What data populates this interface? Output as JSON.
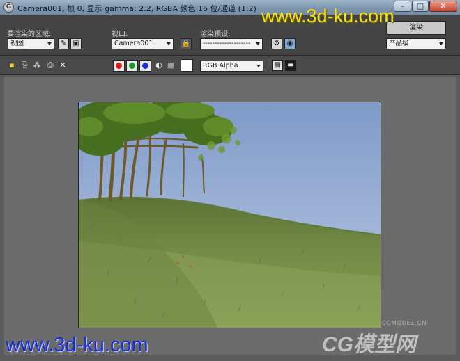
{
  "window": {
    "title": "Camera001, 帧 0, 显示 gamma: 2.2, RGBA 颜色 16 位/通道 (1:2)",
    "app_icon": "3dsmax-icon",
    "minimize": "–",
    "maximize": "□",
    "close": "✕"
  },
  "toolbar": {
    "area_label": "要渲染的区域:",
    "area_value": "视图",
    "viewport_label": "视口:",
    "viewport_value": "Camera001",
    "preset_label": "渲染预设:",
    "preset_value": "--------------------",
    "render_button": "渲染",
    "quality_value": "产品级"
  },
  "bar2": {
    "channel_value": "RGB Alpha",
    "colors": {
      "red": "#d81e1e",
      "green": "#1a9a2a",
      "blue": "#1d2fd4"
    }
  },
  "watermarks": {
    "top": "www.3d-ku.com",
    "bottom": "www.3d-ku.com",
    "cg": "CG模型网",
    "cg_small": "CGMODEL.CN"
  }
}
